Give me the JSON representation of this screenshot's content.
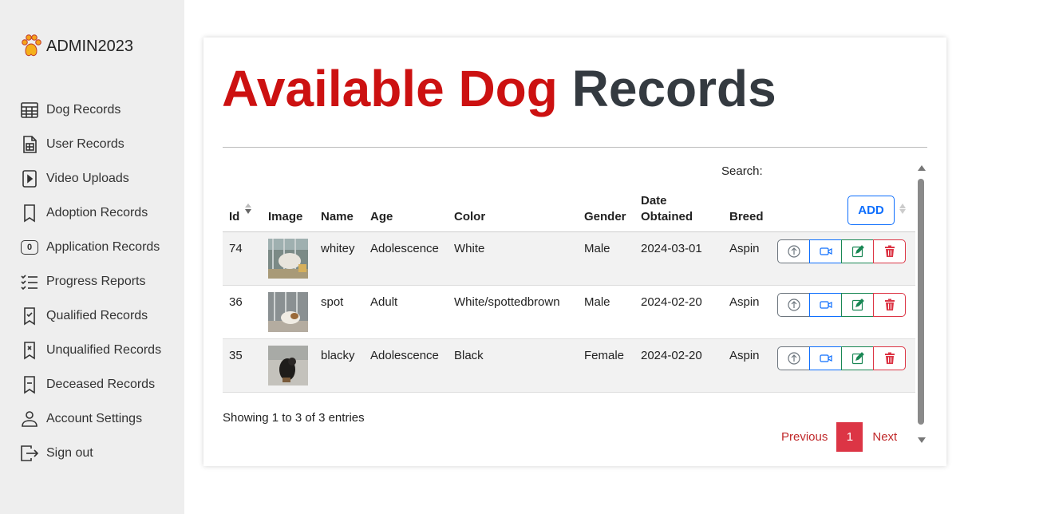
{
  "sidebar": {
    "brand": "ADMIN2023",
    "items": [
      {
        "label": "Dog Records",
        "icon": "table-icon"
      },
      {
        "label": "User Records",
        "icon": "file-spreadsheet-icon"
      },
      {
        "label": "Video Uploads",
        "icon": "file-play-icon"
      },
      {
        "label": "Adoption Records",
        "icon": "bookmark-icon"
      },
      {
        "label": "Application Records",
        "icon": "zero-badge-icon",
        "badge": "0"
      },
      {
        "label": "Progress Reports",
        "icon": "list-check-icon"
      },
      {
        "label": "Qualified Records",
        "icon": "bookmark-check-icon"
      },
      {
        "label": "Unqualified Records",
        "icon": "bookmark-x-icon"
      },
      {
        "label": "Deceased Records",
        "icon": "bookmark-dash-icon"
      },
      {
        "label": "Account Settings",
        "icon": "person-icon"
      },
      {
        "label": "Sign out",
        "icon": "box-arrow-right-icon"
      }
    ]
  },
  "main": {
    "title_red": "Available Dog",
    "title_dark": "Records",
    "search_label": "Search:",
    "add_label": "ADD",
    "columns": [
      "Id",
      "Image",
      "Name",
      "Age",
      "Color",
      "Gender",
      "Date Obtained",
      "Breed"
    ],
    "rows": [
      {
        "id": "74",
        "name": "whitey",
        "age": "Adolescence",
        "color": "White",
        "gender": "Male",
        "date": "2024-03-01",
        "breed": "Aspin"
      },
      {
        "id": "36",
        "name": "spot",
        "age": "Adult",
        "color": "White/spottedbrown",
        "gender": "Male",
        "date": "2024-02-20",
        "breed": "Aspin"
      },
      {
        "id": "35",
        "name": "blacky",
        "age": "Adolescence",
        "color": "Black",
        "gender": "Female",
        "date": "2024-02-20",
        "breed": "Aspin"
      }
    ],
    "info": "Showing 1 to 3 of 3 entries",
    "pagination": {
      "prev": "Previous",
      "current": "1",
      "next": "Next"
    },
    "colors": {
      "title_red": "#cc1111",
      "title_dark": "#343a40",
      "accent_blue": "#0d6efd",
      "danger": "#dc3545",
      "success": "#198754"
    }
  }
}
